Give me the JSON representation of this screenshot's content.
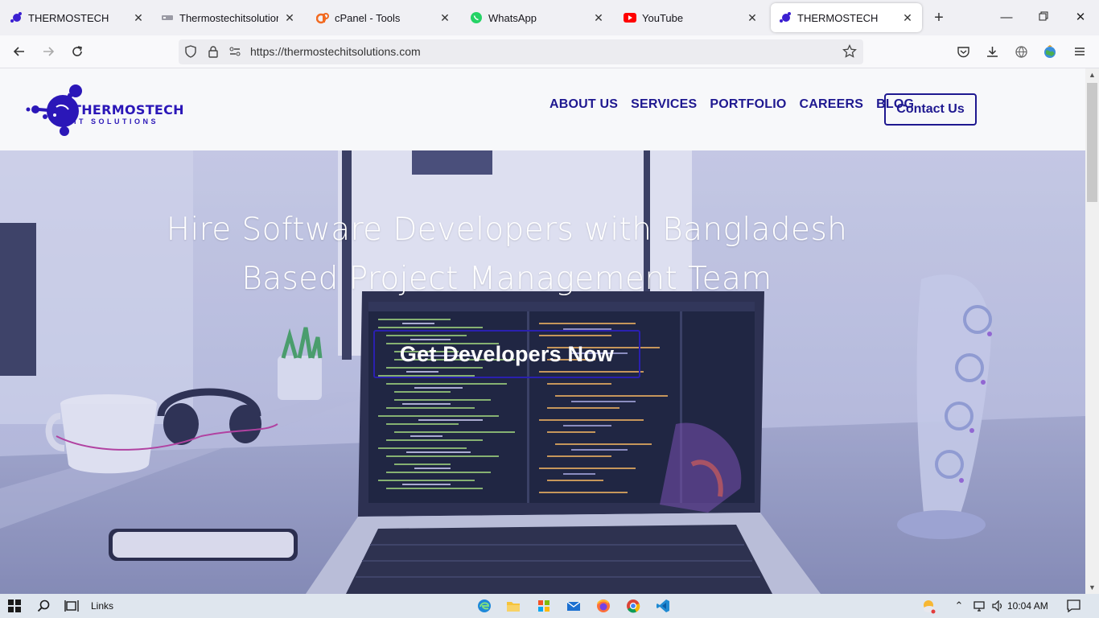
{
  "browser": {
    "tabs": [
      {
        "title": "THERMOSTECH",
        "favicon": "thermostech-icon",
        "active": false
      },
      {
        "title": "Thermostechitsolutions.c",
        "favicon": "site-icon",
        "active": false
      },
      {
        "title": "cPanel - Tools",
        "favicon": "cpanel-icon",
        "active": false
      },
      {
        "title": "WhatsApp",
        "favicon": "whatsapp-icon",
        "active": false
      },
      {
        "title": "YouTube",
        "favicon": "youtube-icon",
        "active": false
      },
      {
        "title": "THERMOSTECH",
        "favicon": "thermostech-icon",
        "active": true
      }
    ],
    "url": "https://thermostechitsolutions.com"
  },
  "site": {
    "logo": {
      "name": "THERMOSTECH",
      "sub": "IT SOLUTIONS"
    },
    "menu": [
      "ABOUT US",
      "SERVICES",
      "PORTFOLIO",
      "CAREERS",
      "BLOG"
    ],
    "contact_label": "Contact Us",
    "hero": {
      "title_line1": "Hire Software Developers with Bangladesh",
      "title_line2": "Based Project Management Team",
      "cta_label": "Get Developers Now"
    },
    "colors": {
      "brand": "#2b17b8",
      "nav_text": "#1e1890"
    }
  },
  "taskbar": {
    "toolbar_label": "Links",
    "time": "10:04 AM"
  }
}
